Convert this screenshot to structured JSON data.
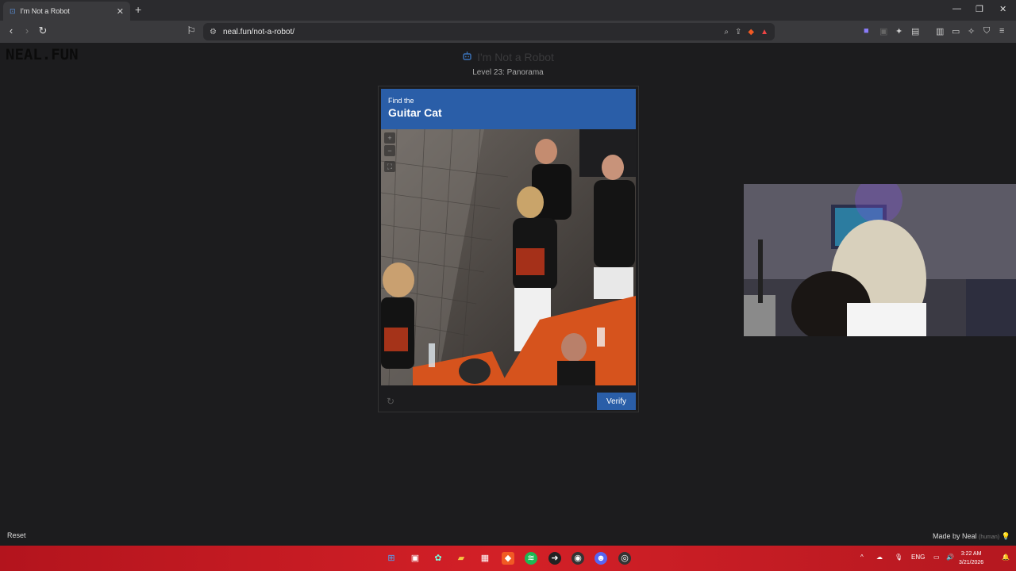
{
  "browser": {
    "tab_title": "I'm Not a Robot",
    "new_tab_symbol": "+",
    "url": "neal.fun/not-a-robot/"
  },
  "page": {
    "logo": "NEAL.FUN",
    "title": "I'm Not a Robot",
    "level": "Level 23: Panorama"
  },
  "captcha": {
    "find_label": "Find the",
    "target": "Guitar Cat",
    "verify_label": "Verify"
  },
  "footer": {
    "reset_label": "Reset",
    "made_by": "Made by Neal",
    "human_tag": "(human)"
  },
  "taskbar": {
    "language": "ENG",
    "time": "3:22 AM",
    "date": "3/21/2026"
  },
  "colors": {
    "accent": "#2a5ea8",
    "taskbar": "#d32027",
    "background": "#1c1c1e"
  }
}
